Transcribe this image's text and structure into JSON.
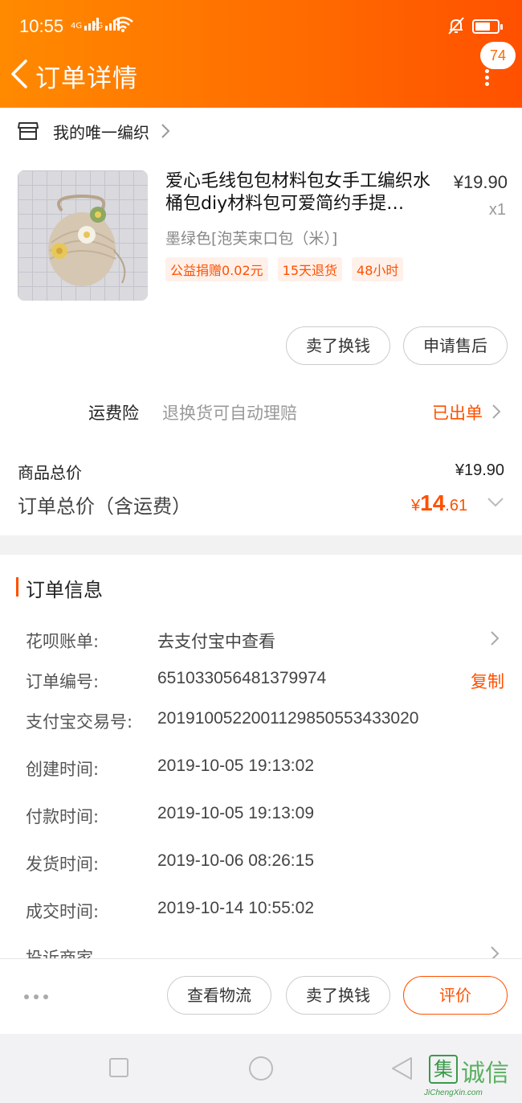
{
  "status_bar": {
    "time": "10:55",
    "signal_1": "4G",
    "signal_2": "2G"
  },
  "header": {
    "title": "订单详情",
    "badge_count": "74"
  },
  "shop": {
    "name": "我的唯一编织"
  },
  "product": {
    "title": "爱心毛线包包材料包女手工编织水桶包diy材料包可爱简约手提…",
    "price": "¥19.90",
    "quantity": "x1",
    "sku": "墨绿色[泡芙束口包（米）]",
    "tags": [
      "公益捐赠0.02元",
      "15天退货",
      "48小时"
    ]
  },
  "item_actions": {
    "sell": "卖了换钱",
    "after_sale": "申请售后"
  },
  "insurance": {
    "label": "运费险",
    "desc": "退换货可自动理赔",
    "status": "已出单"
  },
  "totals": {
    "goods_label": "商品总价",
    "goods_price": "¥19.90",
    "order_label": "订单总价（含运费）",
    "order_currency": "¥",
    "order_int": "14",
    "order_dec": ".61"
  },
  "order_info": {
    "title": "订单信息",
    "rows": [
      {
        "label": "花呗账单:",
        "value": "去支付宝中查看"
      },
      {
        "label": "订单编号:",
        "value": "651033056481379974",
        "action": "复制"
      },
      {
        "label": "支付宝交易号:",
        "value": "2019100522001129850553433020"
      },
      {
        "label": "创建时间:",
        "value": "2019-10-05 19:13:02"
      },
      {
        "label": "付款时间:",
        "value": "2019-10-05 19:13:09"
      },
      {
        "label": "发货时间:",
        "value": "2019-10-06 08:26:15"
      },
      {
        "label": "成交时间:",
        "value": "2019-10-14 10:55:02"
      },
      {
        "label": "投诉商家",
        "value": ""
      }
    ]
  },
  "bottom_actions": {
    "logistics": "查看物流",
    "sell": "卖了换钱",
    "review": "评价"
  },
  "watermark": {
    "brand": "诚信",
    "logo_char": "集",
    "url": "JiChengXin.com"
  },
  "colors": {
    "accent": "#ff5000",
    "header_start": "#ff8a00",
    "header_end": "#ff5000"
  }
}
